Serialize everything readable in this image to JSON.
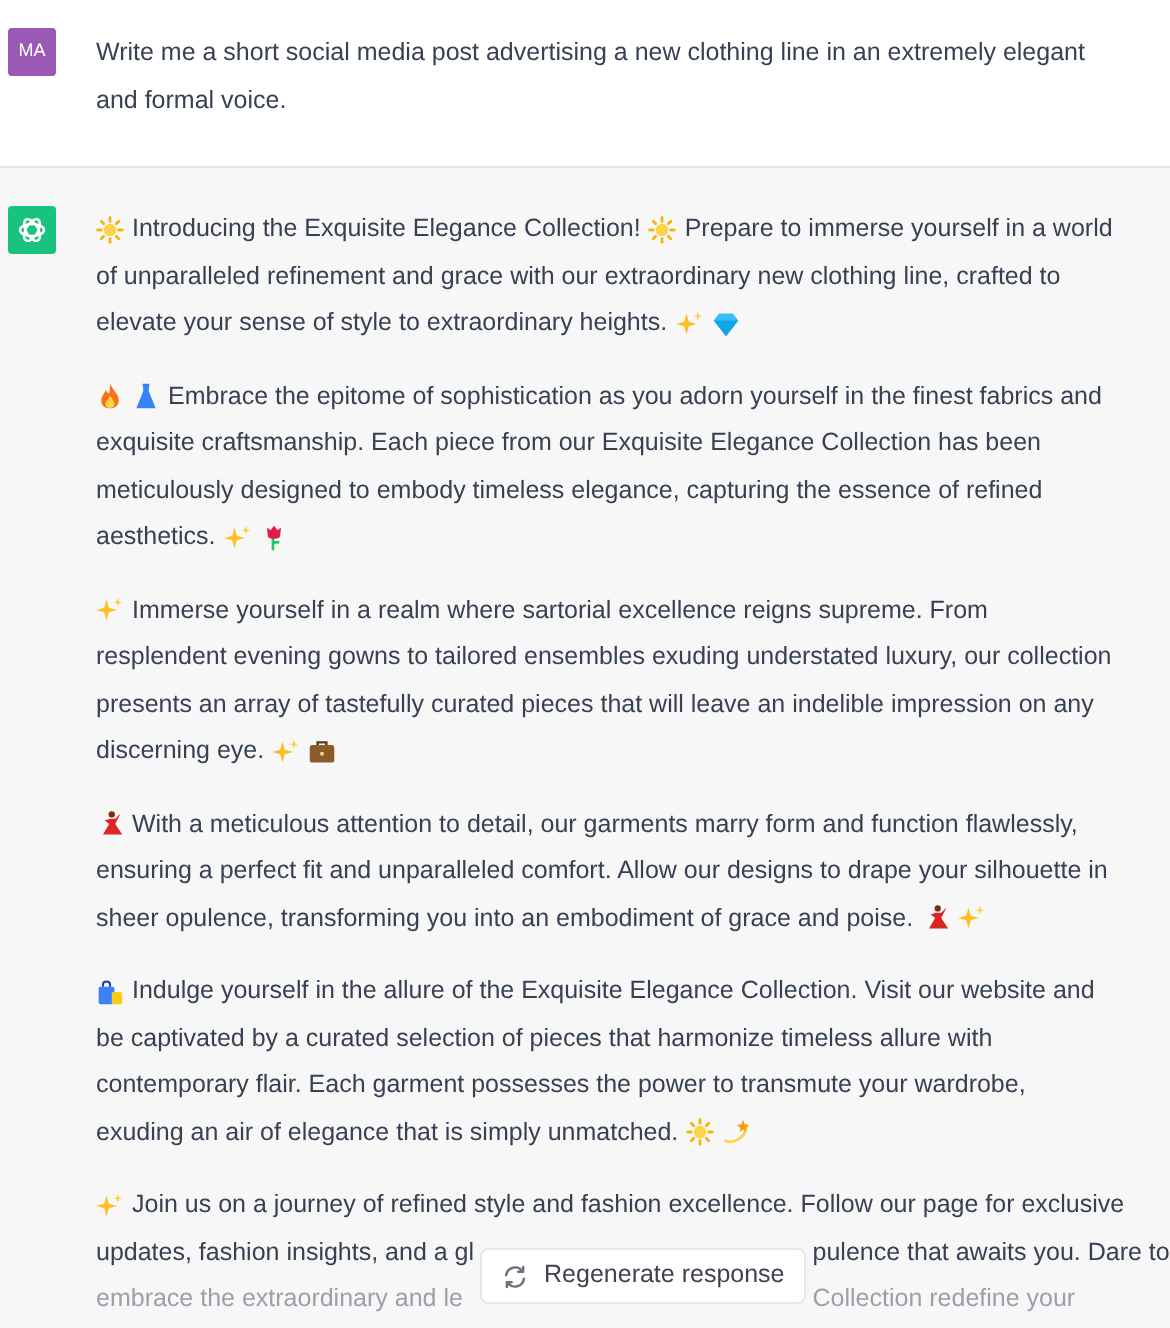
{
  "prompt": {
    "avatar": "MA",
    "text": "Write me a short social media post advertising a new clothing line in an extremely elegant and formal voice."
  },
  "response": {
    "paragraphs": [
      {
        "lines": [
          [
            {
              "kind": "sun"
            },
            {
              "kind": "text",
              "text": "Introducing the Exquisite Elegance Collection!"
            },
            {
              "kind": "sun"
            },
            {
              "kind": "text",
              "text": "Prepare to immerse yourself in a world"
            }
          ],
          [
            {
              "kind": "text",
              "text": "of unparalleled refinement and grace with our extraordinary new clothing line, crafted to"
            }
          ],
          [
            {
              "kind": "text",
              "text": "elevate your sense of style to extraordinary heights."
            },
            {
              "kind": "sparkles"
            },
            {
              "kind": "gem"
            }
          ]
        ]
      },
      {
        "lines": [
          [
            {
              "kind": "fire"
            },
            {
              "kind": "dress"
            },
            {
              "kind": "text",
              "text": "Embrace the epitome of sophistication as you adorn yourself in the finest fabrics and"
            }
          ],
          [
            {
              "kind": "text",
              "text": "exquisite craftsmanship. Each piece from our Exquisite Elegance Collection has been"
            }
          ],
          [
            {
              "kind": "text",
              "text": "meticulously designed to embody timeless elegance, capturing the essence of refined"
            }
          ],
          [
            {
              "kind": "text",
              "text": "aesthetics."
            },
            {
              "kind": "sparkles"
            },
            {
              "kind": "rose"
            }
          ]
        ]
      },
      {
        "lines": [
          [
            {
              "kind": "sparkles"
            },
            {
              "kind": "text",
              "text": "Immerse yourself in a realm where sartorial excellence reigns supreme. From"
            }
          ],
          [
            {
              "kind": "text",
              "text": "resplendent evening gowns to tailored ensembles exuding understated luxury, our collection"
            }
          ],
          [
            {
              "kind": "text",
              "text": "presents an array of tastefully curated pieces that will leave an indelible impression on any"
            }
          ],
          [
            {
              "kind": "text",
              "text": "discerning eye."
            },
            {
              "kind": "sparkles"
            },
            {
              "kind": "briefcase"
            }
          ]
        ]
      },
      {
        "lines": [
          [
            {
              "kind": "dancer"
            },
            {
              "kind": "text",
              "text": "With a meticulous attention to detail, our garments marry form and function flawlessly,"
            }
          ],
          [
            {
              "kind": "text",
              "text": "ensuring a perfect fit and unparalleled comfort. Allow our designs to drape your silhouette in"
            }
          ],
          [
            {
              "kind": "text",
              "text": "sheer opulence, transforming you into an embodiment of grace and poise."
            },
            {
              "kind": "dancer"
            },
            {
              "kind": "sparkles"
            }
          ]
        ]
      },
      {
        "lines": [
          [
            {
              "kind": "bags"
            },
            {
              "kind": "text",
              "text": "Indulge yourself in the allure of the Exquisite Elegance Collection. Visit our website and"
            }
          ],
          [
            {
              "kind": "text",
              "text": "be captivated by a curated selection of pieces that harmonize timeless allure with"
            }
          ],
          [
            {
              "kind": "text",
              "text": "contemporary flair. Each garment possesses the power to transmute your wardrobe,"
            }
          ],
          [
            {
              "kind": "text",
              "text": "exuding an air of elegance that is simply unmatched."
            },
            {
              "kind": "sun"
            },
            {
              "kind": "dizzy"
            }
          ]
        ]
      }
    ],
    "last_paragraph": {
      "first_line": [
        {
          "kind": "sparkles"
        },
        {
          "kind": "text",
          "text": "Join us on a journey of refined style and fashion excellence. Follow our page for exclusive"
        }
      ],
      "line_2_left": "updates, fashion insights, and a gl",
      "line_2_right": "pulence that awaits you. Dare to",
      "line_3_left": "embrace the extraordinary and le",
      "line_3_right": "Collection redefine your"
    }
  },
  "regenerate_button": {
    "label": "Regenerate response"
  }
}
